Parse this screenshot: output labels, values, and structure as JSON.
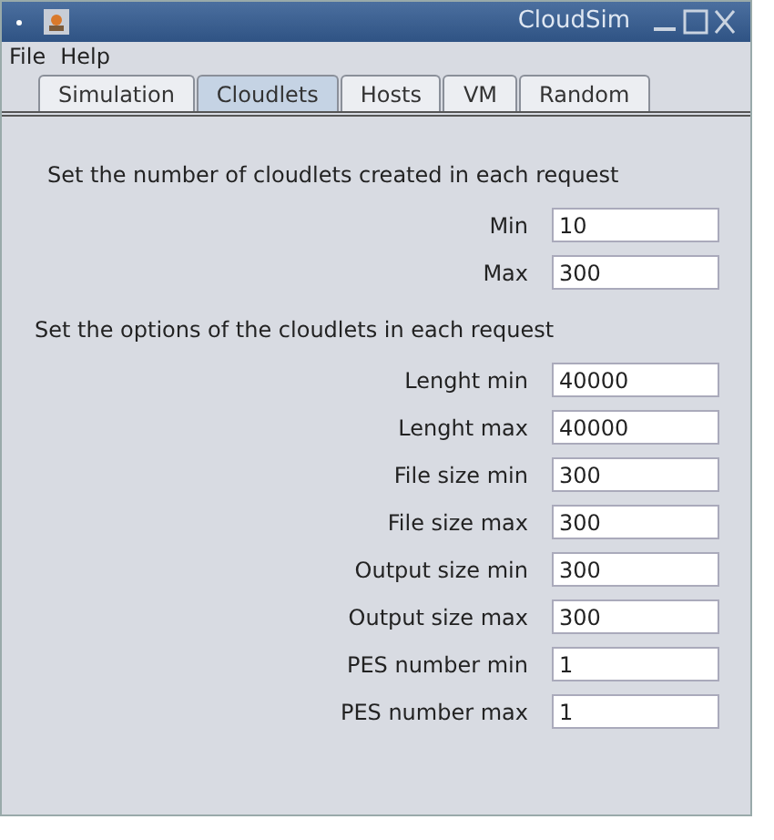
{
  "window": {
    "title": "CloudSim"
  },
  "menu": [
    "File",
    "Help"
  ],
  "tabs": [
    {
      "label": "Simulation",
      "selected": false
    },
    {
      "label": "Cloudlets",
      "selected": true
    },
    {
      "label": "Hosts",
      "selected": false
    },
    {
      "label": "VM",
      "selected": false
    },
    {
      "label": "Random",
      "selected": false
    }
  ],
  "sections": [
    {
      "heading": "Set the number of cloudlets created in each request",
      "fields": [
        {
          "label": "Min",
          "value": "10"
        },
        {
          "label": "Max",
          "value": "300"
        }
      ]
    },
    {
      "heading": "Set the options of the cloudlets in each request",
      "fields": [
        {
          "label": "Lenght min",
          "value": "40000"
        },
        {
          "label": "Lenght max",
          "value": "40000"
        },
        {
          "label": "File size min",
          "value": "300"
        },
        {
          "label": "File size max",
          "value": "300"
        },
        {
          "label": "Output size min",
          "value": "300"
        },
        {
          "label": "Output size max",
          "value": "300"
        },
        {
          "label": "PES number min",
          "value": "1"
        },
        {
          "label": "PES number max",
          "value": "1"
        }
      ]
    }
  ]
}
